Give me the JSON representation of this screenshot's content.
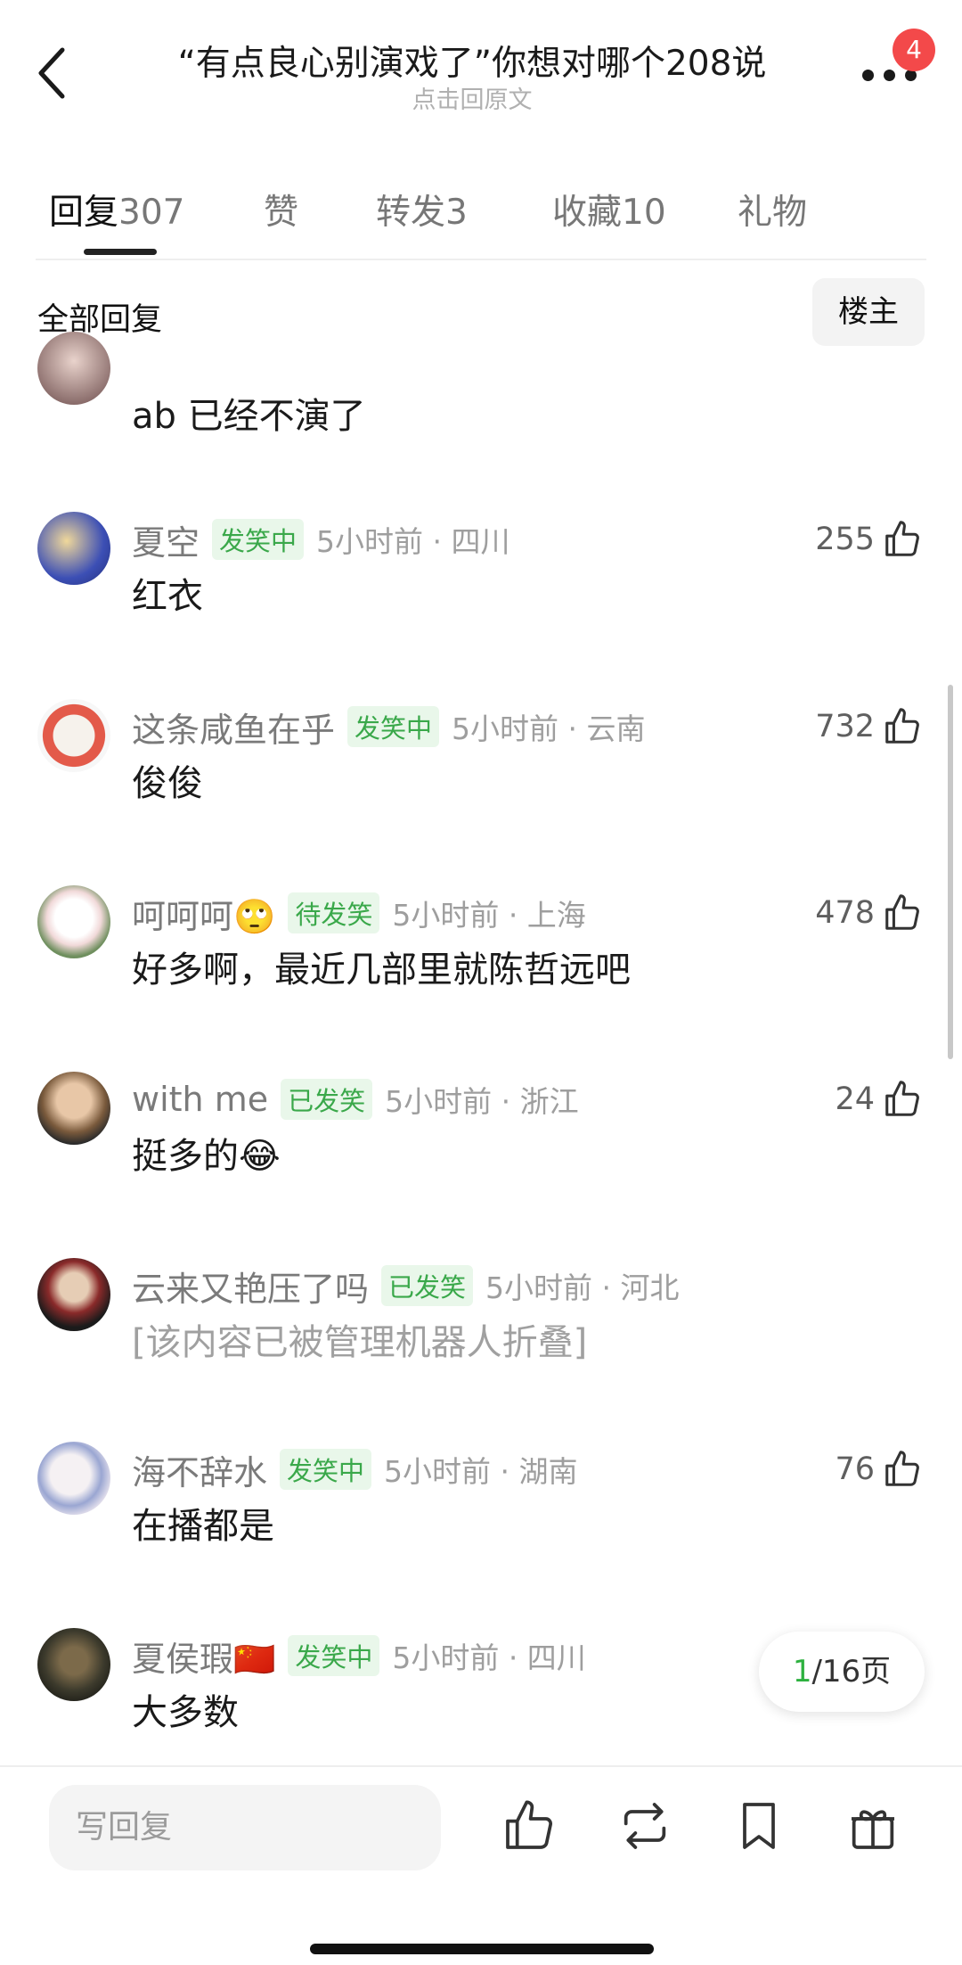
{
  "header": {
    "title": "“有点良心别演戏了”你想对哪个208说",
    "subtitle": "点击回原文",
    "badge_count": "4"
  },
  "tabs": [
    {
      "label": "回复",
      "count": "307"
    },
    {
      "label": "赞",
      "count": ""
    },
    {
      "label": "转发",
      "count": "3"
    },
    {
      "label": "收藏",
      "count": "10"
    },
    {
      "label": "礼物",
      "count": ""
    }
  ],
  "filter": {
    "label": "全部回复",
    "button": "楼主"
  },
  "partial_comment": {
    "text": "ab  已经不演了"
  },
  "comments": [
    {
      "name": "夏空",
      "tag": "发笑中",
      "time": "5小时前 · 四川",
      "text": "红衣",
      "likes": "255"
    },
    {
      "name": "这条咸鱼在乎",
      "tag": "发笑中",
      "time": "5小时前 · 云南",
      "text": "俊俊",
      "likes": "732"
    },
    {
      "name": "呵呵呵🙄",
      "tag": "待发笑",
      "time": "5小时前 · 上海",
      "text": "好多啊，最近几部里就陈哲远吧",
      "likes": "478"
    },
    {
      "name": "with me",
      "tag": "已发笑",
      "time": "5小时前 · 浙江",
      "text": "挺多的😂",
      "likes": "24"
    },
    {
      "name": "云来又艳压了吗",
      "tag": "已发笑",
      "time": "5小时前 · 河北",
      "text": "[该内容已被管理机器人折叠]",
      "likes": ""
    },
    {
      "name": "海不辞水",
      "tag": "发笑中",
      "time": "5小时前 · 湖南",
      "text": "在播都是",
      "likes": "76"
    },
    {
      "name": "夏侯瑕🇨🇳",
      "tag": "发笑中",
      "time": "5小时前 · 四川",
      "text": "大多数",
      "likes": ""
    }
  ],
  "pager": {
    "current": "1",
    "total": "/16页"
  },
  "bottom_bar": {
    "reply_placeholder": "写回复"
  },
  "colors": {
    "accent_green": "#3aa84a",
    "badge_red": "#f3494a"
  },
  "icons": [
    "back-arrow-icon",
    "more-dots-icon",
    "thumbs-up-icon",
    "repost-icon",
    "bookmark-icon",
    "gift-icon"
  ]
}
